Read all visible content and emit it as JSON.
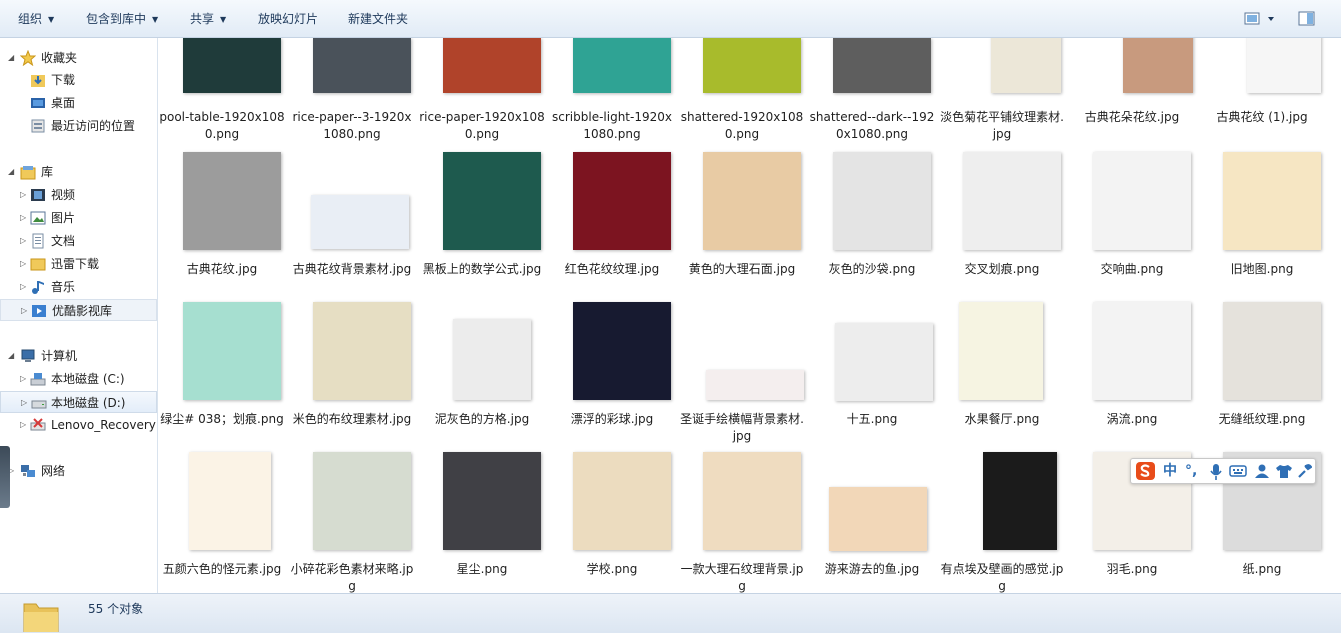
{
  "toolbar": {
    "organize": "组织",
    "include_in_library": "包含到库中",
    "share": "共享",
    "slideshow": "放映幻灯片",
    "new_folder": "新建文件夹"
  },
  "sidebar": {
    "favorites": {
      "label": "收藏夹",
      "items": [
        "下载",
        "桌面",
        "最近访问的位置"
      ]
    },
    "libraries": {
      "label": "库",
      "items": [
        "视频",
        "图片",
        "文档",
        "迅雷下载",
        "音乐",
        "优酷影视库"
      ]
    },
    "computer": {
      "label": "计算机",
      "items": [
        "本地磁盘 (C:)",
        "本地磁盘 (D:)",
        "Lenovo_Recovery ("
      ]
    },
    "network": {
      "label": "网络"
    }
  },
  "files": [
    {
      "name": "pool-table-1920x1080.png",
      "color": "#1f3b3a"
    },
    {
      "name": "rice-paper--3-1920x1080.png",
      "color": "#4a525a"
    },
    {
      "name": "rice-paper-1920x1080.png",
      "color": "#b0432a"
    },
    {
      "name": "scribble-light-1920x1080.png",
      "color": "#2fa394"
    },
    {
      "name": "shattered-1920x1080.png",
      "color": "#a8bb2c"
    },
    {
      "name": "shattered--dark--1920x1080.png",
      "color": "#5e5e5e"
    },
    {
      "name": "淡色菊花平铺纹理素材.jpg",
      "color": "#ece7d8"
    },
    {
      "name": "古典花朵花纹.jpg",
      "color": "#c89a7e"
    },
    {
      "name": "古典花纹 (1).jpg",
      "color": "#f6f6f6"
    },
    {
      "name": "古典花纹.jpg",
      "color": "#9c9c9c"
    },
    {
      "name": "古典花纹背景素材.jpg",
      "color": "#e9eef5"
    },
    {
      "name": "黑板上的数学公式.jpg",
      "color": "#1e5a4e"
    },
    {
      "name": "红色花纹纹理.jpg",
      "color": "#7c1420"
    },
    {
      "name": "黄色的大理石面.jpg",
      "color": "#e8cba4"
    },
    {
      "name": "灰色的沙袋.png",
      "color": "#e4e4e4"
    },
    {
      "name": "交叉划痕.png",
      "color": "#eeeeee"
    },
    {
      "name": "交响曲.png",
      "color": "#f3f3f3"
    },
    {
      "name": "旧地图.png",
      "color": "#f6e6c3"
    },
    {
      "name": "绿尘# 038；划痕.png",
      "color": "#a6dfd0"
    },
    {
      "name": "米色的布纹理素材.jpg",
      "color": "#e6dec3"
    },
    {
      "name": "泥灰色的方格.jpg",
      "color": "#ececec"
    },
    {
      "name": "漂浮的彩球.jpg",
      "color": "#171a30"
    },
    {
      "name": "圣诞手绘横幅背景素材.jpg",
      "color": "#f4eeee"
    },
    {
      "name": "十五.png",
      "color": "#ededed"
    },
    {
      "name": "水果餐厅.png",
      "color": "#f6f4e2"
    },
    {
      "name": "涡流.png",
      "color": "#f3f3f3"
    },
    {
      "name": "无缝纸纹理.png",
      "color": "#e5e2dc"
    },
    {
      "name": "五颜六色的怪元素.jpg",
      "color": "#fbf3e6"
    },
    {
      "name": "小碎花彩色素材来略.jpg",
      "color": "#d6dcd0"
    },
    {
      "name": "星尘.png",
      "color": "#404045"
    },
    {
      "name": "学校.png",
      "color": "#ecdcbf"
    },
    {
      "name": "一款大理石纹理背景.jpg",
      "color": "#efdcc0"
    },
    {
      "name": "游来游去的鱼.jpg",
      "color": "#f2d7b8"
    },
    {
      "name": "有点埃及壁画的感觉.jpg",
      "color": "#1b1b1b"
    },
    {
      "name": "羽毛.png",
      "color": "#f3efe8"
    },
    {
      "name": "纸.png",
      "color": "#dcdcdc"
    }
  ],
  "status": {
    "count": "55 个对象"
  },
  "ime": {
    "chinese": "中",
    "punct": "°,"
  }
}
